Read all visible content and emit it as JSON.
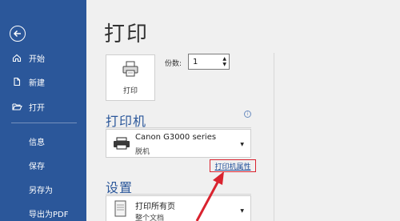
{
  "sidebar": {
    "back_icon": "back-arrow-icon",
    "items": [
      {
        "label": "开始",
        "icon": "home-icon"
      },
      {
        "label": "新建",
        "icon": "new-document-icon"
      },
      {
        "label": "打开",
        "icon": "folder-open-icon"
      },
      {
        "label": "信息"
      },
      {
        "label": "保存"
      },
      {
        "label": "另存为"
      },
      {
        "label": "导出为PDF"
      }
    ]
  },
  "main": {
    "title": "打印",
    "print_button_label": "打印",
    "copies_label": "份数:",
    "copies_value": "1",
    "printer_section_title": "打印机",
    "printer_name": "Canon G3000 series",
    "printer_status": "脱机",
    "printer_properties_link": "打印机属性",
    "settings_section_title": "设置",
    "settings_option_title": "打印所有页",
    "settings_option_sub": "整个文档"
  },
  "colors": {
    "sidebar_bg": "#2b579a",
    "accent": "#2b579a",
    "highlight_border": "#d9232f"
  }
}
